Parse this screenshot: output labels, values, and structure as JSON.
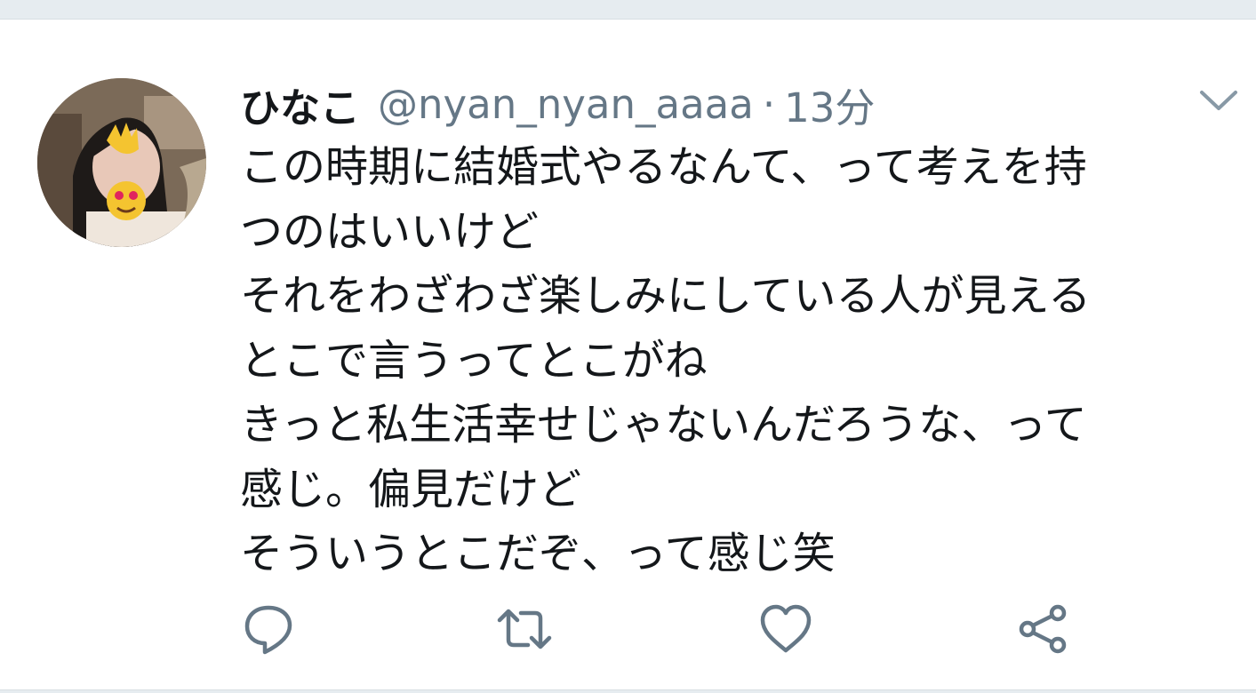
{
  "tweet": {
    "display_name": "ひなこ",
    "handle": "@nyan_nyan_aaaa",
    "separator": "·",
    "timestamp": "13分",
    "body_lines": [
      "この時期に結婚式やるなんて、って考えを持",
      "つのはいいけど",
      "それをわざわざ楽しみにしている人が見える",
      "とこで言うってとこがね",
      "きっと私生活幸せじゃないんだろうな、って",
      "感じ。偏見だけど",
      "そういうとこだぞ、って感じ笑"
    ]
  },
  "icons": {
    "caret": "chevron-down-icon",
    "reply": "reply-icon",
    "retweet": "retweet-icon",
    "like": "heart-icon",
    "share": "share-icon"
  },
  "colors": {
    "text": "#14171a",
    "muted": "#657786",
    "divider": "#e6ecf0",
    "icon": "#657786"
  }
}
